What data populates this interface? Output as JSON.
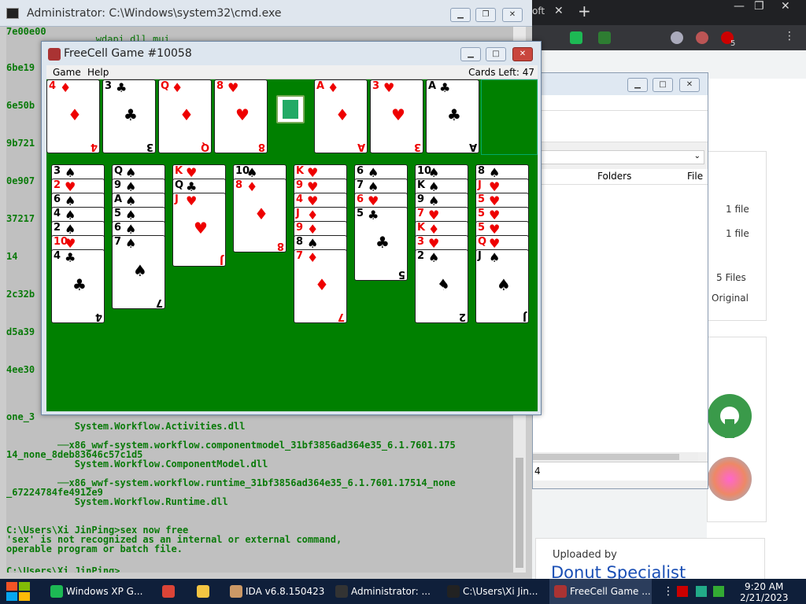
{
  "browser": {
    "tab_partial": "oft",
    "close_tab": "✕",
    "new_tab": "+",
    "min": "—",
    "max": "❐",
    "close": "✕",
    "badge": "5"
  },
  "explorer": {
    "col_folders": "Folders",
    "col_file": "File",
    "rows": [
      "1 file",
      "1 file",
      "5 Files",
      "Original"
    ],
    "footer": "4"
  },
  "web": {
    "uploaded_by": "Uploaded by",
    "uploader": "Donut Specialist"
  },
  "cmd": {
    "title": "Administrator: C:\\Windows\\system32\\cmd.exe",
    "left_col": [
      "7e00e00",
      "6be19",
      "6e50b",
      "9b721",
      "0e907",
      "37217",
      "14",
      "2c32b",
      "d5a39",
      "4ee30"
    ],
    "top_line": "        wdapi.dll.mui",
    "lines": [
      "one_3                        ",
      "            System.Workflow.Activities.dll",
      "         ──x86_wwf-system.workflow.componentmodel_31bf3856ad364e35_6.1.7601.175",
      "14_none_8deb83646c57c1d5",
      "            System.Workflow.ComponentModel.dll",
      "         ──x86_wwf-system.workflow.runtime_31bf3856ad364e35_6.1.7601.17514_none",
      "_67224784fe4912e9",
      "            System.Workflow.Runtime.dll",
      "",
      "C:\\Users\\Xi JinPing>sex now free",
      "'sex' is not recognized as an internal or external command,",
      "operable program or batch file.",
      "",
      "C:\\Users\\Xi JinPing>"
    ]
  },
  "freecell": {
    "title": "FreeCell Game #10058",
    "menu": [
      "Game",
      "Help"
    ],
    "cards_left": "Cards Left: 47",
    "free_cells": [
      {
        "rank": "4",
        "suit": "♦",
        "color": "red"
      },
      {
        "rank": "3",
        "suit": "♣",
        "color": "blk"
      },
      {
        "rank": "Q",
        "suit": "♦",
        "color": "red"
      },
      {
        "rank": "8",
        "suit": "♥",
        "color": "red"
      }
    ],
    "foundations": [
      {
        "rank": "A",
        "suit": "♦",
        "color": "red"
      },
      {
        "rank": "3",
        "suit": "♥",
        "color": "red"
      },
      {
        "rank": "A",
        "suit": "♣",
        "color": "blk"
      }
    ],
    "columns": [
      [
        {
          "r": "3",
          "s": "♠",
          "c": "blk"
        },
        {
          "r": "2",
          "s": "♥",
          "c": "red"
        },
        {
          "r": "6",
          "s": "♠",
          "c": "blk"
        },
        {
          "r": "4",
          "s": "♠",
          "c": "blk"
        },
        {
          "r": "2",
          "s": "♠",
          "c": "blk"
        },
        {
          "r": "10",
          "s": "♥",
          "c": "red"
        },
        {
          "r": "4",
          "s": "♣",
          "c": "blk"
        }
      ],
      [
        {
          "r": "Q",
          "s": "♠",
          "c": "blk"
        },
        {
          "r": "9",
          "s": "♠",
          "c": "blk"
        },
        {
          "r": "A",
          "s": "♠",
          "c": "blk"
        },
        {
          "r": "5",
          "s": "♠",
          "c": "blk"
        },
        {
          "r": "6",
          "s": "♠",
          "c": "blk"
        },
        {
          "r": "7",
          "s": "♠",
          "c": "blk"
        }
      ],
      [
        {
          "r": "K",
          "s": "♥",
          "c": "red"
        },
        {
          "r": "Q",
          "s": "♣",
          "c": "blk"
        },
        {
          "r": "J",
          "s": "♥",
          "c": "red"
        }
      ],
      [
        {
          "r": "10",
          "s": "♠",
          "c": "blk"
        },
        {
          "r": "8",
          "s": "♦",
          "c": "red"
        }
      ],
      [
        {
          "r": "K",
          "s": "♥",
          "c": "red"
        },
        {
          "r": "9",
          "s": "♥",
          "c": "red"
        },
        {
          "r": "4",
          "s": "♥",
          "c": "red"
        },
        {
          "r": "J",
          "s": "♦",
          "c": "red"
        },
        {
          "r": "9",
          "s": "♦",
          "c": "red"
        },
        {
          "r": "8",
          "s": "♠",
          "c": "blk"
        },
        {
          "r": "7",
          "s": "♦",
          "c": "red"
        }
      ],
      [
        {
          "r": "6",
          "s": "♠",
          "c": "blk"
        },
        {
          "r": "7",
          "s": "♠",
          "c": "blk"
        },
        {
          "r": "6",
          "s": "♥",
          "c": "red"
        },
        {
          "r": "5",
          "s": "♣",
          "c": "blk"
        }
      ],
      [
        {
          "r": "10",
          "s": "♠",
          "c": "blk"
        },
        {
          "r": "K",
          "s": "♠",
          "c": "blk"
        },
        {
          "r": "9",
          "s": "♠",
          "c": "blk"
        },
        {
          "r": "7",
          "s": "♥",
          "c": "red"
        },
        {
          "r": "K",
          "s": "♦",
          "c": "red"
        },
        {
          "r": "3",
          "s": "♥",
          "c": "red"
        },
        {
          "r": "2",
          "s": "♠",
          "c": "blk"
        }
      ],
      [
        {
          "r": "8",
          "s": "♠",
          "c": "blk"
        },
        {
          "r": "J",
          "s": "♥",
          "c": "red"
        },
        {
          "r": "5",
          "s": "♥",
          "c": "red"
        },
        {
          "r": "5",
          "s": "♥",
          "c": "red"
        },
        {
          "r": "5",
          "s": "♥",
          "c": "red"
        },
        {
          "r": "Q",
          "s": "♥",
          "c": "red"
        },
        {
          "r": "J",
          "s": "♠",
          "c": "blk"
        }
      ]
    ]
  },
  "taskbar": {
    "items": [
      {
        "label": "Windows XP G...",
        "icon": "chat-icon",
        "color": "#1db954"
      },
      {
        "label": "",
        "icon": "chrome-icon",
        "color": "#db4437"
      },
      {
        "label": "",
        "icon": "folder-icon",
        "color": "#f4c542"
      },
      {
        "label": "IDA v6.8.150423",
        "icon": "ida-icon",
        "color": "#c96"
      },
      {
        "label": "Administrator: ...",
        "icon": "cmd-icon",
        "color": "#333"
      },
      {
        "label": "C:\\Users\\Xi Jin...",
        "icon": "7zip-icon",
        "color": "#222"
      },
      {
        "label": "FreeCell Game ...",
        "icon": "freecell-icon",
        "color": "#a33"
      }
    ],
    "time": "9:20 AM",
    "date": "2/21/2023"
  }
}
